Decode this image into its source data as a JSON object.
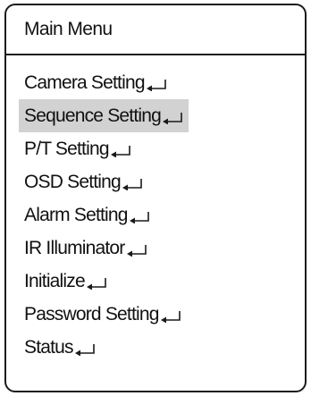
{
  "menu": {
    "title": "Main Menu",
    "items": [
      {
        "label": "Camera Setting",
        "selected": false,
        "icon": "enter-icon"
      },
      {
        "label": "Sequence Setting",
        "selected": true,
        "icon": "enter-icon"
      },
      {
        "label": "P/T Setting",
        "selected": false,
        "icon": "enter-icon"
      },
      {
        "label": "OSD Setting",
        "selected": false,
        "icon": "enter-icon"
      },
      {
        "label": "Alarm Setting",
        "selected": false,
        "icon": "enter-icon"
      },
      {
        "label": "IR Illuminator",
        "selected": false,
        "icon": "enter-icon"
      },
      {
        "label": "Initialize",
        "selected": false,
        "icon": "enter-icon"
      },
      {
        "label": "Password Setting",
        "selected": false,
        "icon": "enter-icon"
      },
      {
        "label": "Status",
        "selected": false,
        "icon": "enter-icon"
      }
    ]
  },
  "colors": {
    "border": "#1a1a1a",
    "highlight": "#d2d2d2",
    "text": "#111111",
    "background": "#ffffff"
  }
}
